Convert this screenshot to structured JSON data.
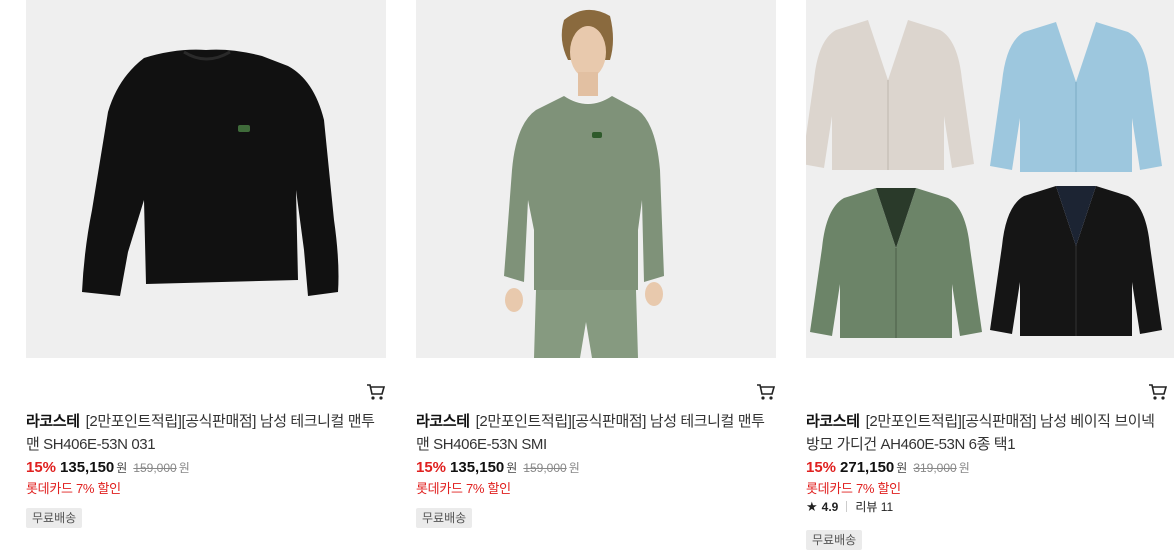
{
  "products": [
    {
      "brand": "라코스테",
      "name": "[2만포인트적립][공식판매점] 남성 테크니컬 맨투맨 SH406E-53N 031",
      "discount": "15%",
      "price": "135,150",
      "currency": "원",
      "original_price": "159,000",
      "card_promo": "롯데카드 7% 할인",
      "badge": "무료배송",
      "image": "black-crewneck-sweater",
      "cart_icon": "cart-icon"
    },
    {
      "brand": "라코스테",
      "name": "[2만포인트적립][공식판매점] 남성 테크니컬 맨투맨 SH406E-53N SMI",
      "discount": "15%",
      "price": "135,150",
      "currency": "원",
      "original_price": "159,000",
      "card_promo": "롯데카드 7% 할인",
      "badge": "무료배송",
      "image": "model-green-sweatshirt",
      "cart_icon": "cart-icon"
    },
    {
      "brand": "라코스테",
      "name": "[2만포인트적립][공식판매점] 남성 베이직 브이넥 방모 가디건 AH460E-53N 6종 택1",
      "discount": "15%",
      "price": "271,150",
      "currency": "원",
      "original_price": "319,000",
      "card_promo": "롯데카드 7% 할인",
      "rating": "4.9",
      "review_label": "리뷰 11",
      "badge": "무료배송",
      "image": "four-cardigans-grid",
      "cart_icon": "cart-icon"
    }
  ],
  "colors": {
    "discount": "#e0201f",
    "image_bg": "#efefef",
    "badge_bg": "#ebebeb"
  }
}
